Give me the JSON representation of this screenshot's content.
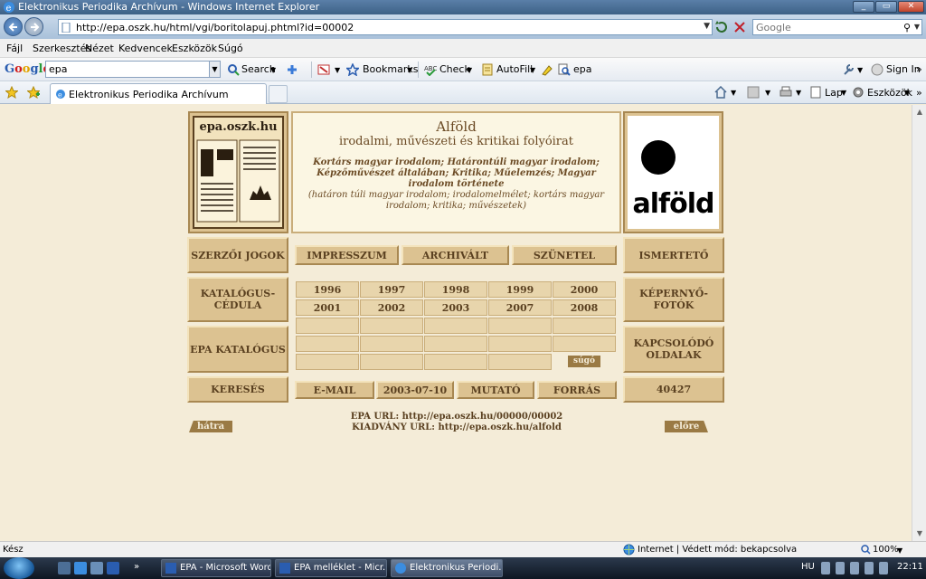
{
  "window": {
    "title": "Elektronikus Periodika Archívum - Windows Internet Explorer"
  },
  "addressbar": {
    "url": "http://epa.oszk.hu/html/vgi/boritolapuj.phtml?id=00002",
    "search_placeholder": "Google"
  },
  "menubar": {
    "items": [
      "Fájl",
      "Szerkesztés",
      "Nézet",
      "Kedvencek",
      "Eszközök",
      "Súgó"
    ]
  },
  "google_toolbar": {
    "logo": "Google",
    "query": "epa",
    "search_label": "Search",
    "bookmarks_label": "Bookmarks",
    "check_label": "Check",
    "autofill_label": "AutoFill",
    "highlight_term": "epa",
    "signin_label": "Sign In"
  },
  "tabs": {
    "active_title": "Elektronikus Periodika Archívum",
    "page_label": "Lap",
    "tools_label": "Eszközök"
  },
  "page": {
    "left_logo_text": "epa.oszk.hu",
    "right_logo_text": "alföld",
    "title": "Alföld",
    "subtitle": "irodalmi, művészeti és kritikai folyóirat",
    "topics": "Kortárs magyar irodalom; Határontúli magyar irodalom; Képzőművészet általában; Kritika; Műelemzés; Magyar irodalom története",
    "keywords": "(határon túli magyar irodalom; irodalomelmélet; kortárs magyar irodalom; kritika; művészetek)",
    "left_buttons": [
      "SZERZŐI JOGOK",
      "KATALÓGUS-CÉDULA",
      "EPA KATALÓGUS",
      "KERESÉS"
    ],
    "right_buttons": [
      "ISMERTETŐ",
      "KÉPERNYŐ-FOTÓK",
      "KAPCSOLÓDÓ OLDALAK",
      "40427"
    ],
    "top_buttons": [
      "IMPRESSZUM",
      "ARCHIVÁLT",
      "SZÜNETEL"
    ],
    "years_row1": [
      "1996",
      "1997",
      "1998",
      "1999",
      "2000"
    ],
    "years_row2": [
      "2001",
      "2002",
      "2003",
      "2007",
      "2008"
    ],
    "help_label": "súgó",
    "bottom_buttons": [
      "E-MAIL",
      "2003-07-10",
      "MUTATÓ",
      "FORRÁS"
    ],
    "epa_url": "EPA URL: http://epa.oszk.hu/00000/00002",
    "kiadvany_url": "KIADVÁNY URL: http://epa.oszk.hu/alfold",
    "back_label": "hátra",
    "forward_label": "előre"
  },
  "statusbar": {
    "left": "Kész",
    "zone": "Internet | Védett mód: bekapcsolva",
    "zoom": "100%"
  },
  "taskbar": {
    "buttons": [
      "EPA - Microsoft Word",
      "EPA melléklet - Micr...",
      "Elektronikus Periodi..."
    ],
    "lang": "HU",
    "time": "22:11"
  }
}
